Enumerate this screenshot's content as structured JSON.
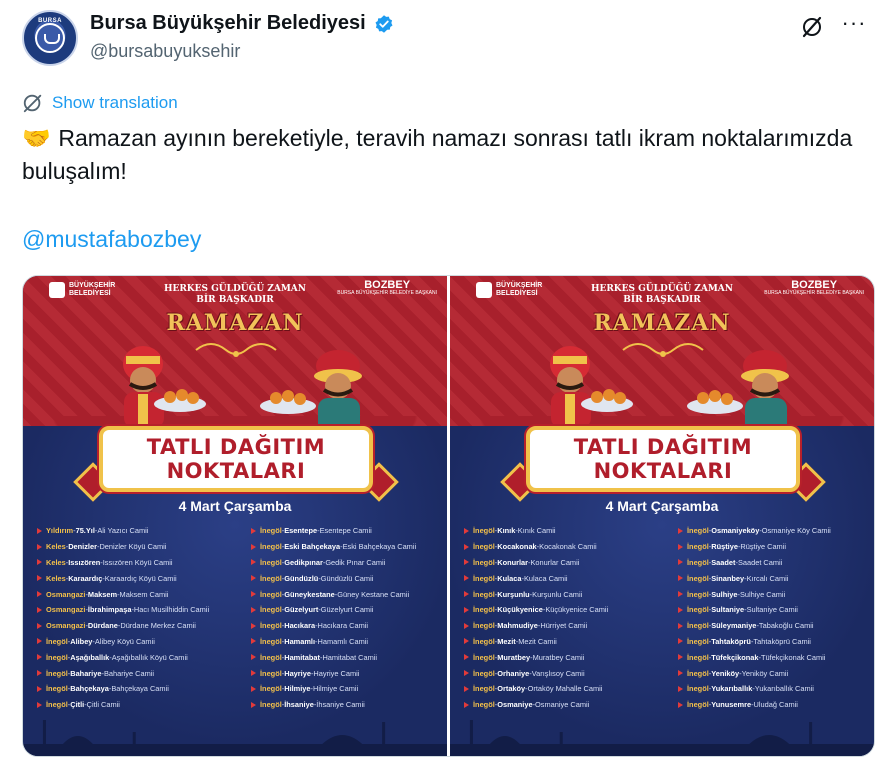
{
  "account": {
    "display_name": "Bursa Büyükşehir Belediyesi",
    "handle": "@bursabuyuksehir",
    "avatar_text": "BURSA",
    "verified": true
  },
  "actions": {
    "grok_icon": "slash-circle-icon",
    "more_icon": "more-dots-icon"
  },
  "translate": {
    "label": "Show translation"
  },
  "tweet": {
    "emoji": "🤝",
    "text": "Ramazan ayının bereketiyle, teravih namazı sonrası tatlı ikram noktalarımızda buluşalım!",
    "mention": "@mustafabozbey"
  },
  "colors": {
    "link": "#1d9bf0",
    "poster_red": "#b01e2b",
    "poster_blue": "#23336e",
    "poster_gold": "#f0c24a"
  },
  "posters": [
    {
      "logo_left": "BÜYÜKŞEHİR BELEDİYESİ",
      "logo_right": "BOZBEY",
      "logo_right_sub": "BURSA BÜYÜKŞEHİR BELEDİYE BAŞKANI",
      "headline_1": "HERKES GÜLDÜĞÜ ZAMAN",
      "headline_2": "BİR BAŞKADIR",
      "headline_3": "RAMAZAN",
      "banner_1": "TATLI DAĞITIM",
      "banner_2": "NOKTALARI",
      "date": "4 Mart Çarşamba",
      "left": [
        {
          "d": "Yıldırım",
          "p": "75.Yıl",
          "m": "Ali Yazıcı Camii"
        },
        {
          "d": "Keles",
          "p": "Denizler",
          "m": "Denizler Köyü Camii"
        },
        {
          "d": "Keles",
          "p": "Issızören",
          "m": "Issızören Köyü Camii"
        },
        {
          "d": "Keles",
          "p": "Karaardıç",
          "m": "Karaardıç Köyü Camii"
        },
        {
          "d": "Osmangazi",
          "p": "Maksem",
          "m": "Maksem Camii"
        },
        {
          "d": "Osmangazi",
          "p": "İbrahimpaşa",
          "m": "Hacı Musilhiddin Camii"
        },
        {
          "d": "Osmangazi",
          "p": "Dürdane",
          "m": "Dürdane Merkez Camii"
        },
        {
          "d": "İnegöl",
          "p": "Alibey",
          "m": "Alibey Köyü Camii"
        },
        {
          "d": "İnegöl",
          "p": "Aşağıballık",
          "m": "Aşağıballık Köyü Camii"
        },
        {
          "d": "İnegöl",
          "p": "Bahariye",
          "m": "Bahariye Camii"
        },
        {
          "d": "İnegöl",
          "p": "Bahçekaya",
          "m": "Bahçekaya Camii"
        },
        {
          "d": "İnegöl",
          "p": "Çitli",
          "m": "Çitli Camii"
        }
      ],
      "right": [
        {
          "d": "İnegöl",
          "p": "Esentepe",
          "m": "Esentepe Camii"
        },
        {
          "d": "İnegöl",
          "p": "Eski Bahçekaya",
          "m": "Eski Bahçekaya Camii"
        },
        {
          "d": "İnegöl",
          "p": "Gedikpınar",
          "m": "Gedik Pınar Camii"
        },
        {
          "d": "İnegöl",
          "p": "Gündüzlü",
          "m": "Gündüzlü Camii"
        },
        {
          "d": "İnegöl",
          "p": "Güneykestane",
          "m": "Güney Kestane Camii"
        },
        {
          "d": "İnegöl",
          "p": "Güzelyurt",
          "m": "Güzelyurt Camii"
        },
        {
          "d": "İnegöl",
          "p": "Hacıkara",
          "m": "Hacıkara Camii"
        },
        {
          "d": "İnegöl",
          "p": "Hamamlı",
          "m": "Hamamlı Camii"
        },
        {
          "d": "İnegöl",
          "p": "Hamitabat",
          "m": "Hamitabat Camii"
        },
        {
          "d": "İnegöl",
          "p": "Hayriye",
          "m": "Hayriye Camii"
        },
        {
          "d": "İnegöl",
          "p": "Hilmiye",
          "m": "Hilmiye Camii"
        },
        {
          "d": "İnegöl",
          "p": "İhsaniye",
          "m": "İhsaniye Camii"
        }
      ]
    },
    {
      "logo_left": "BÜYÜKŞEHİR BELEDİYESİ",
      "logo_right": "BOZBEY",
      "logo_right_sub": "BURSA BÜYÜKŞEHİR BELEDİYE BAŞKANI",
      "headline_1": "HERKES GÜLDÜĞÜ ZAMAN",
      "headline_2": "BİR BAŞKADIR",
      "headline_3": "RAMAZAN",
      "banner_1": "TATLI DAĞITIM",
      "banner_2": "NOKTALARI",
      "date": "4 Mart Çarşamba",
      "left": [
        {
          "d": "İnegöl",
          "p": "Kınık",
          "m": "Kınık Camii"
        },
        {
          "d": "İnegöl",
          "p": "Kocakonak",
          "m": "Kocakonak Camii"
        },
        {
          "d": "İnegöl",
          "p": "Konurlar",
          "m": "Konurlar Camii"
        },
        {
          "d": "İnegöl",
          "p": "Kulaca",
          "m": "Kulaca Camii"
        },
        {
          "d": "İnegöl",
          "p": "Kurşunlu",
          "m": "Kurşunlu Camii"
        },
        {
          "d": "İnegöl",
          "p": "Küçükyenice",
          "m": "Küçükyenice Camii"
        },
        {
          "d": "İnegöl",
          "p": "Mahmudiye",
          "m": "Hürriyet Camii"
        },
        {
          "d": "İnegöl",
          "p": "Mezit",
          "m": "Mezit Camii"
        },
        {
          "d": "İnegöl",
          "p": "Muratbey",
          "m": "Muratbey Camii"
        },
        {
          "d": "İnegöl",
          "p": "Orhaniye",
          "m": "Varışlısoy Camii"
        },
        {
          "d": "İnegöl",
          "p": "Ortaköy",
          "m": "Ortaköy Mahalle Camii"
        },
        {
          "d": "İnegöl",
          "p": "Osmaniye",
          "m": "Osmaniye Camii"
        }
      ],
      "right": [
        {
          "d": "İnegöl",
          "p": "Osmaniyeköy",
          "m": "Osmaniye Köy Camii"
        },
        {
          "d": "İnegöl",
          "p": "Rüştiye",
          "m": "Rüştiye Camii"
        },
        {
          "d": "İnegöl",
          "p": "Saadet",
          "m": "Saadet Camii"
        },
        {
          "d": "İnegöl",
          "p": "Sinanbey",
          "m": "Kırcalı Camii"
        },
        {
          "d": "İnegöl",
          "p": "Sulhiye",
          "m": "Sulhiye Camii"
        },
        {
          "d": "İnegöl",
          "p": "Sultaniye",
          "m": "Sultaniye Camii"
        },
        {
          "d": "İnegöl",
          "p": "Süleymaniye",
          "m": "Tabakoğlu Camii"
        },
        {
          "d": "İnegöl",
          "p": "Tahtaköprü",
          "m": "Tahtaköprü Camii"
        },
        {
          "d": "İnegöl",
          "p": "Tüfekçikonak",
          "m": "Tüfekçikonak Camii"
        },
        {
          "d": "İnegöl",
          "p": "Yeniköy",
          "m": "Yeniköy Camii"
        },
        {
          "d": "İnegöl",
          "p": "Yukarıballık",
          "m": "Yukarıballık Camii"
        },
        {
          "d": "İnegöl",
          "p": "Yunusemre",
          "m": "Uludağ Camii"
        }
      ]
    }
  ]
}
